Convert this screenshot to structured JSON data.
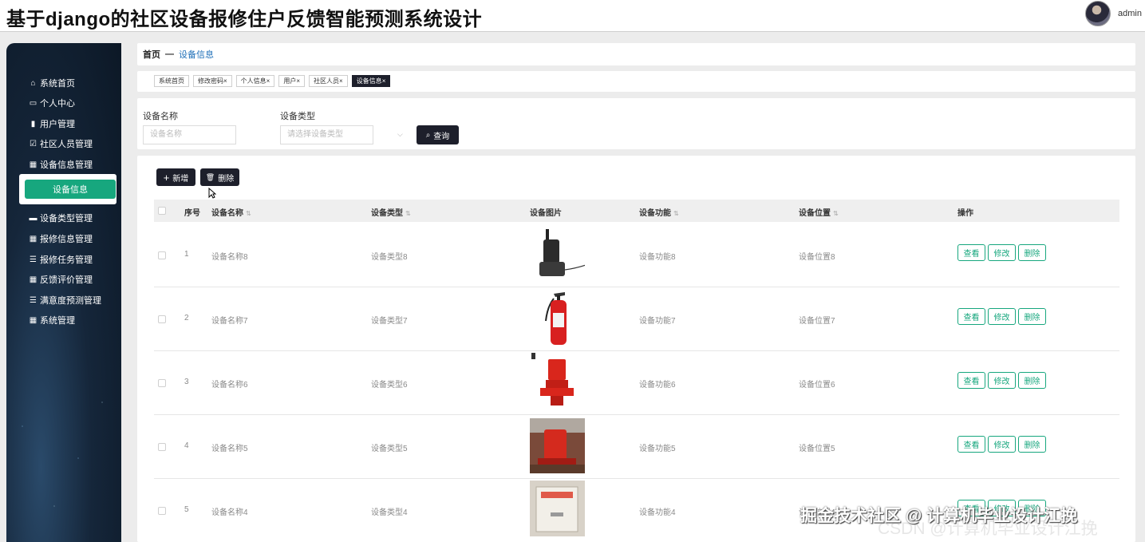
{
  "header": {
    "title": "基于django的社区设备报修住户反馈智能预测系统设计",
    "user": "admin"
  },
  "sidebar": {
    "items": [
      {
        "label": "系统首页",
        "icon": "home-icon",
        "glyph": "⌂"
      },
      {
        "label": "个人中心",
        "icon": "id-card-icon",
        "glyph": "▭"
      },
      {
        "label": "用户管理",
        "icon": "clipboard-icon",
        "glyph": "▮"
      },
      {
        "label": "社区人员管理",
        "icon": "checkbox-icon",
        "glyph": "☑"
      },
      {
        "label": "设备信息管理",
        "icon": "grid-icon",
        "glyph": "▦"
      },
      {
        "label": "设备类型管理",
        "icon": "stack-icon",
        "glyph": "▬"
      },
      {
        "label": "报修信息管理",
        "icon": "grid-icon",
        "glyph": "▦"
      },
      {
        "label": "报修任务管理",
        "icon": "list-icon",
        "glyph": "☰"
      },
      {
        "label": "反馈评价管理",
        "icon": "grid-icon",
        "glyph": "▦"
      },
      {
        "label": "满意度预测管理",
        "icon": "sliders-icon",
        "glyph": "☰"
      },
      {
        "label": "系统管理",
        "icon": "grid-icon",
        "glyph": "▦"
      }
    ],
    "active": "设备信息"
  },
  "breadcrumb": {
    "home": "首页",
    "sep": "—",
    "current": "设备信息"
  },
  "tags": [
    {
      "label": "系统首页",
      "closable": false
    },
    {
      "label": "修改密码",
      "closable": true
    },
    {
      "label": "个人信息",
      "closable": true
    },
    {
      "label": "用户",
      "closable": true
    },
    {
      "label": "社区人员",
      "closable": true
    },
    {
      "label": "设备信息",
      "closable": true,
      "active": true
    }
  ],
  "search": {
    "name_label": "设备名称",
    "name_placeholder": "设备名称",
    "type_label": "设备类型",
    "type_placeholder": "请选择设备类型",
    "query_button": "查询"
  },
  "actions": {
    "add": "新增",
    "delete": "删除"
  },
  "table": {
    "columns": [
      "序号",
      "设备名称",
      "设备类型",
      "设备图片",
      "设备功能",
      "设备位置",
      "操作"
    ],
    "rows": [
      {
        "no": "1",
        "name": "设备名称8",
        "type": "设备类型8",
        "func": "设备功能8",
        "loc": "设备位置8",
        "pic": "walkie-talkie"
      },
      {
        "no": "2",
        "name": "设备名称7",
        "type": "设备类型7",
        "func": "设备功能7",
        "loc": "设备位置7",
        "pic": "fire-extinguisher"
      },
      {
        "no": "3",
        "name": "设备名称6",
        "type": "设备类型6",
        "func": "设备功能6",
        "loc": "设备位置6",
        "pic": "fire-pump"
      },
      {
        "no": "4",
        "name": "设备名称5",
        "type": "设备类型5",
        "func": "设备功能5",
        "loc": "设备位置5",
        "pic": "pump-room"
      },
      {
        "no": "5",
        "name": "设备名称4",
        "type": "设备类型4",
        "func": "设备功能4",
        "loc": "设备位置4",
        "pic": "fire-box"
      }
    ],
    "row_ops": {
      "view": "查看",
      "edit": "修改",
      "delete": "删除"
    }
  },
  "watermark": {
    "line1": "掘金技术社区 @ 计算机毕业设计江挽",
    "line2": "CSDN @计算机毕业设计江挽"
  },
  "colors": {
    "accent": "#17a77e",
    "dark_button": "#1d1f2b",
    "link": "#1e6fb8"
  }
}
